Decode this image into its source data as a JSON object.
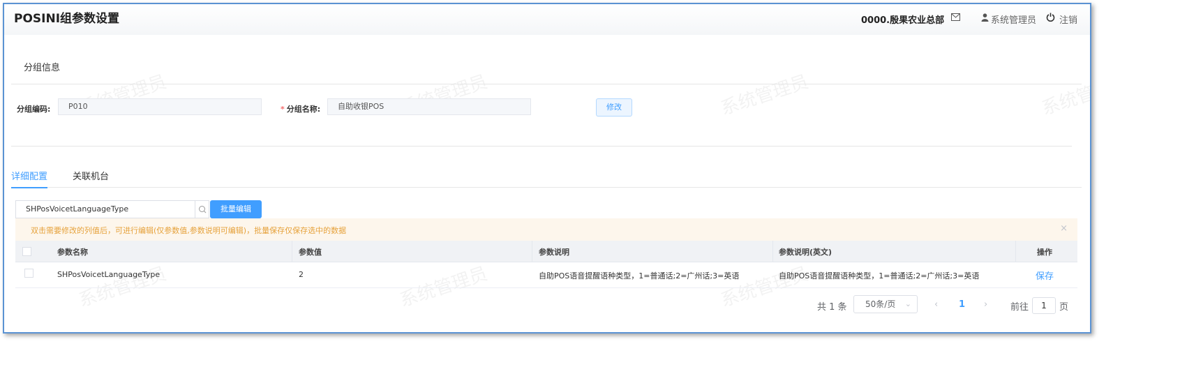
{
  "header": {
    "title": "POSINI组参数设置",
    "org": "0000.殷果农业总部",
    "user": "系统管理员",
    "logout": "注销",
    "icons": [
      "mail-icon",
      "user-icon",
      "power-icon"
    ]
  },
  "watermark": "系统管理员",
  "group_info": {
    "section_title": "分组信息",
    "code_label": "分组编码:",
    "code_value": "P010",
    "name_label": "分组名称:",
    "name_value": "自助收银POS",
    "edit_button": "修改"
  },
  "tabs": [
    {
      "label": "详细配置",
      "active": true
    },
    {
      "label": "关联机台",
      "active": false
    }
  ],
  "toolbar": {
    "search_value": "SHPosVoicetLanguageType",
    "batch_edit": "批量编辑"
  },
  "alert": {
    "text": "双击需要修改的列值后，可进行编辑(仅参数值,参数说明可编辑)，批量保存仅保存选中的数据",
    "close": "×"
  },
  "table": {
    "columns": [
      "参数名称",
      "参数值",
      "参数说明",
      "参数说明(英文)",
      "操作"
    ],
    "rows": [
      {
        "name": "SHPosVoicetLanguageType",
        "value": "2",
        "desc": "自助POS语音提醒语种类型，1=普通话;2=广州话;3=英语",
        "desc_en": "自助POS语音提醒语种类型，1=普通话;2=广州话;3=英语",
        "action": "保存"
      }
    ]
  },
  "pagination": {
    "total": "共 1 条",
    "page_size": "50条/页",
    "current": "1",
    "goto_prefix": "前往",
    "goto_value": "1",
    "goto_suffix": "页"
  },
  "colors": {
    "primary": "#409eff",
    "warning": "#e6a23c",
    "frame": "#5b93d3"
  }
}
